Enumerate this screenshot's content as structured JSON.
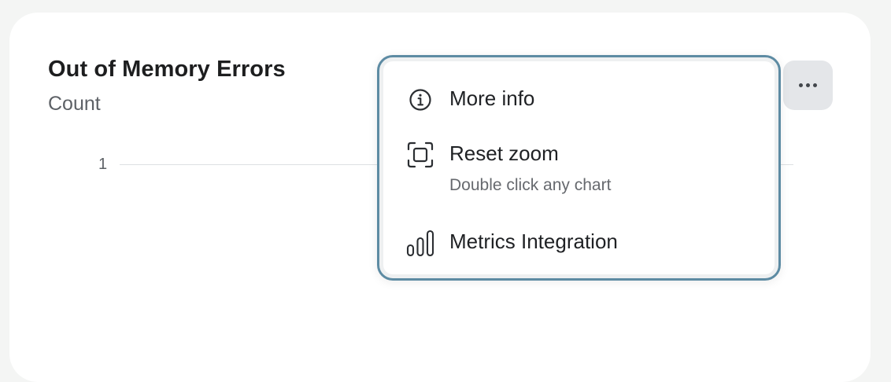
{
  "card": {
    "title": "Out of Memory Errors",
    "subtitle": "Count",
    "y_tick": "1"
  },
  "more_button": {
    "icon": "ellipsis-icon"
  },
  "menu": {
    "items": [
      {
        "label": "More info",
        "icon": "info-icon"
      },
      {
        "label": "Reset zoom",
        "hint": "Double click any chart",
        "icon": "reset-zoom-icon"
      },
      {
        "label": "Metrics Integration",
        "icon": "bar-chart-icon"
      }
    ]
  },
  "colors": {
    "background": "#f4f5f4",
    "card": "#ffffff",
    "menu_border": "#5d8ba3",
    "more_button_bg": "#e4e6e9",
    "text_primary": "#1f2124",
    "text_secondary": "#5d6166"
  }
}
